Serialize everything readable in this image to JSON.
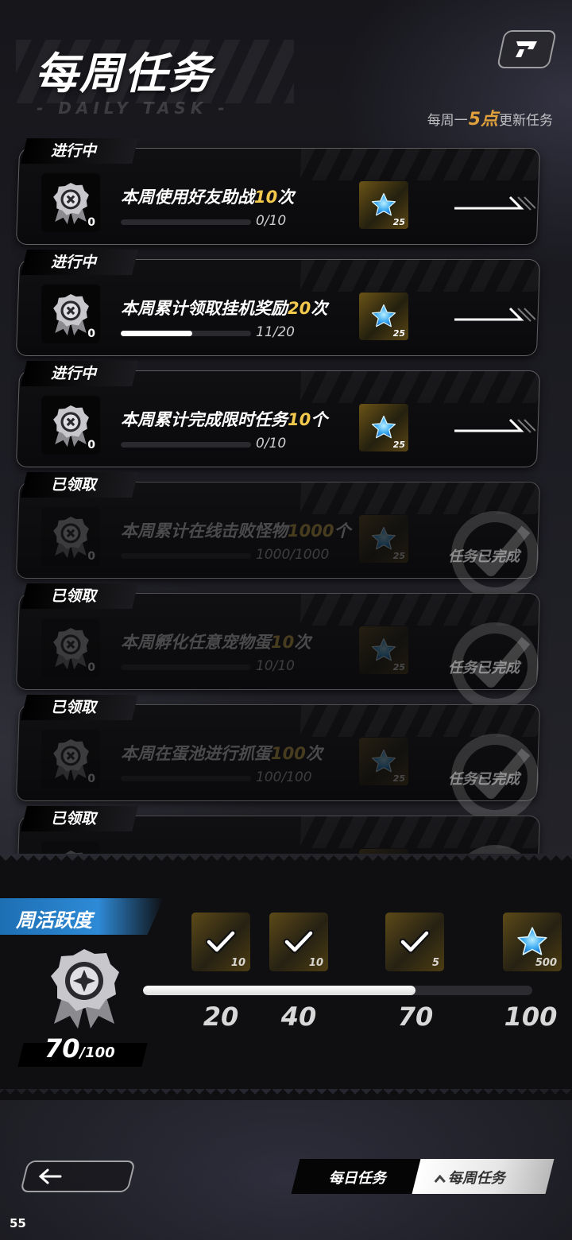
{
  "header": {
    "title": "每周任务",
    "subtitle": "- DAILY TASK -",
    "refresh_prefix": "每周一",
    "refresh_highlight": "5点",
    "refresh_suffix": "更新任务"
  },
  "tasks": [
    {
      "status": "进行中",
      "title_pre": "本周使用好友助战",
      "title_num": "10",
      "title_post": "次",
      "progress_text": "0/10",
      "progress": 0.0,
      "medal_count": "0",
      "reward_count": "25",
      "done": false
    },
    {
      "status": "进行中",
      "title_pre": "本周累计领取挂机奖励",
      "title_num": "20",
      "title_post": "次",
      "progress_text": "11/20",
      "progress": 0.55,
      "medal_count": "0",
      "reward_count": "25",
      "done": false
    },
    {
      "status": "进行中",
      "title_pre": "本周累计完成限时任务",
      "title_num": "10",
      "title_post": "个",
      "progress_text": "0/10",
      "progress": 0.0,
      "medal_count": "0",
      "reward_count": "25",
      "done": false
    },
    {
      "status": "已领取",
      "title_pre": "本周累计在线击败怪物",
      "title_num": "1000",
      "title_post": "个",
      "progress_text": "1000/1000",
      "progress": 1.0,
      "medal_count": "0",
      "reward_count": "25",
      "done": true,
      "done_label": "任务已完成"
    },
    {
      "status": "已领取",
      "title_pre": "本周孵化任意宠物蛋",
      "title_num": "10",
      "title_post": "次",
      "progress_text": "10/10",
      "progress": 1.0,
      "medal_count": "0",
      "reward_count": "25",
      "done": true,
      "done_label": "任务已完成"
    },
    {
      "status": "已领取",
      "title_pre": "本周在蛋池进行抓蛋",
      "title_num": "100",
      "title_post": "次",
      "progress_text": "100/100",
      "progress": 1.0,
      "medal_count": "0",
      "reward_count": "25",
      "done": true,
      "done_label": "任务已完成"
    },
    {
      "status": "已领取",
      "title_pre": "",
      "title_num": "",
      "title_post": "",
      "progress_text": "",
      "progress": 1.0,
      "medal_count": "",
      "reward_count": "",
      "done": true,
      "done_label": ""
    }
  ],
  "activity": {
    "label": "周活跃度",
    "current": "70",
    "max": "/100",
    "progress": 0.7,
    "milestones": [
      {
        "value": "20",
        "count": "10",
        "icon": "claimed-check-icon",
        "pos": 0.2
      },
      {
        "value": "40",
        "count": "10",
        "icon": "claimed-check-icon",
        "pos": 0.4
      },
      {
        "value": "70",
        "count": "5",
        "icon": "claimed-check-icon",
        "pos": 0.7
      },
      {
        "value": "100",
        "count": "500",
        "icon": "blue-star-icon",
        "pos": 1.0
      }
    ]
  },
  "nav": {
    "back_icon": "back-arrow-icon",
    "tab_daily": "每日任务",
    "tab_weekly": "每周任务"
  },
  "fps": "55",
  "colors": {
    "accent_gold": "#e0a13c",
    "number_yellow": "#f2c94c",
    "activity_blue": "#2e8ad6"
  }
}
